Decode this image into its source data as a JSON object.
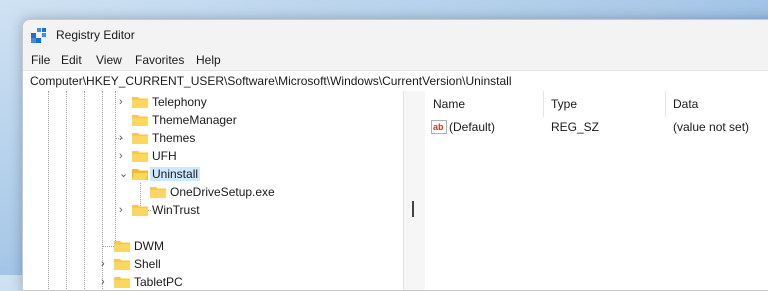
{
  "window": {
    "title": "Registry Editor"
  },
  "menu": [
    "File",
    "Edit",
    "View",
    "Favorites",
    "Help"
  ],
  "address": "Computer\\HKEY_CURRENT_USER\\Software\\Microsoft\\Windows\\CurrentVersion\\Uninstall",
  "tree": {
    "items": [
      {
        "label": "Telephony",
        "expander": "collapsed"
      },
      {
        "label": "ThemeManager",
        "expander": "none"
      },
      {
        "label": "Themes",
        "expander": "collapsed"
      },
      {
        "label": "UFH",
        "expander": "collapsed"
      },
      {
        "label": "Uninstall",
        "expander": "expanded",
        "selected": true
      },
      {
        "label": "OneDriveSetup.exe",
        "expander": "none"
      },
      {
        "label": "WinTrust",
        "expander": "collapsed"
      },
      {
        "label": "DWM",
        "expander": "none"
      },
      {
        "label": "Shell",
        "expander": "collapsed"
      },
      {
        "label": "TabletPC",
        "expander": "collapsed"
      }
    ]
  },
  "list": {
    "columns": [
      "Name",
      "Type",
      "Data"
    ],
    "rows": [
      {
        "name": "(Default)",
        "type": "REG_SZ",
        "data": "(value not set)",
        "icon": "string-value-icon"
      }
    ]
  },
  "colors": {
    "selection": "#cde8ff",
    "folder": "#f7c948",
    "desktop_accent": "#5f97cf"
  }
}
